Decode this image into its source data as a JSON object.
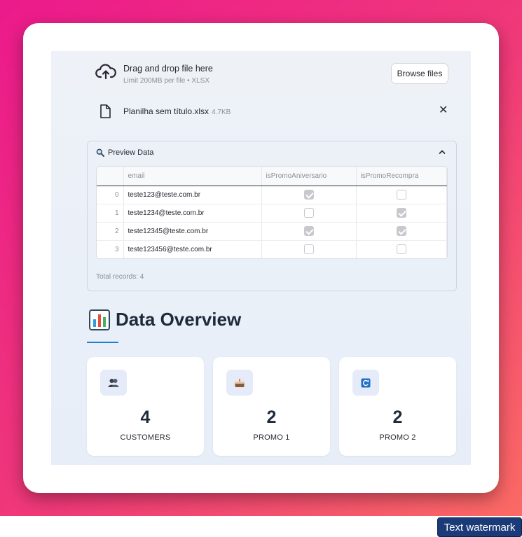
{
  "uploader": {
    "title": "Drag and drop file here",
    "limit": "Limit 200MB per file • XLSX",
    "browse_label": "Browse files",
    "icon": "cloud-upload-icon"
  },
  "file": {
    "name": "Planilha sem título.xlsx",
    "size": "4.7KB",
    "icon": "file-icon",
    "close_icon": "close-icon"
  },
  "preview": {
    "header_icon": "magnifier-icon",
    "header": "Preview Data",
    "columns": [
      "",
      "email",
      "isPromoAniversario",
      "isPromoRecompra"
    ],
    "rows": [
      {
        "index": "0",
        "email": "teste123@teste.com.br",
        "isPromoAniversario": true,
        "isPromoRecompra": false
      },
      {
        "index": "1",
        "email": "teste1234@teste.com.br",
        "isPromoAniversario": false,
        "isPromoRecompra": true
      },
      {
        "index": "2",
        "email": "teste12345@teste.com.br",
        "isPromoAniversario": true,
        "isPromoRecompra": true
      },
      {
        "index": "3",
        "email": "teste123456@teste.com.br",
        "isPromoAniversario": false,
        "isPromoRecompra": false
      }
    ],
    "total": "Total records: 4"
  },
  "overview": {
    "icon": "bar-chart-icon",
    "title": "Data Overview",
    "accent": "#1f7fcf",
    "stats": [
      {
        "icon": "people-icon",
        "value": "4",
        "label": "CUSTOMERS"
      },
      {
        "icon": "cake-icon",
        "value": "2",
        "label": "PROMO 1"
      },
      {
        "icon": "refresh-icon",
        "value": "2",
        "label": "PROMO 2"
      }
    ]
  },
  "watermark": "Text watermark",
  "colors": {
    "background_start": "#ec1a8c",
    "background_end": "#fb6a64",
    "text": "#262730",
    "muted": "#8b8e97"
  }
}
